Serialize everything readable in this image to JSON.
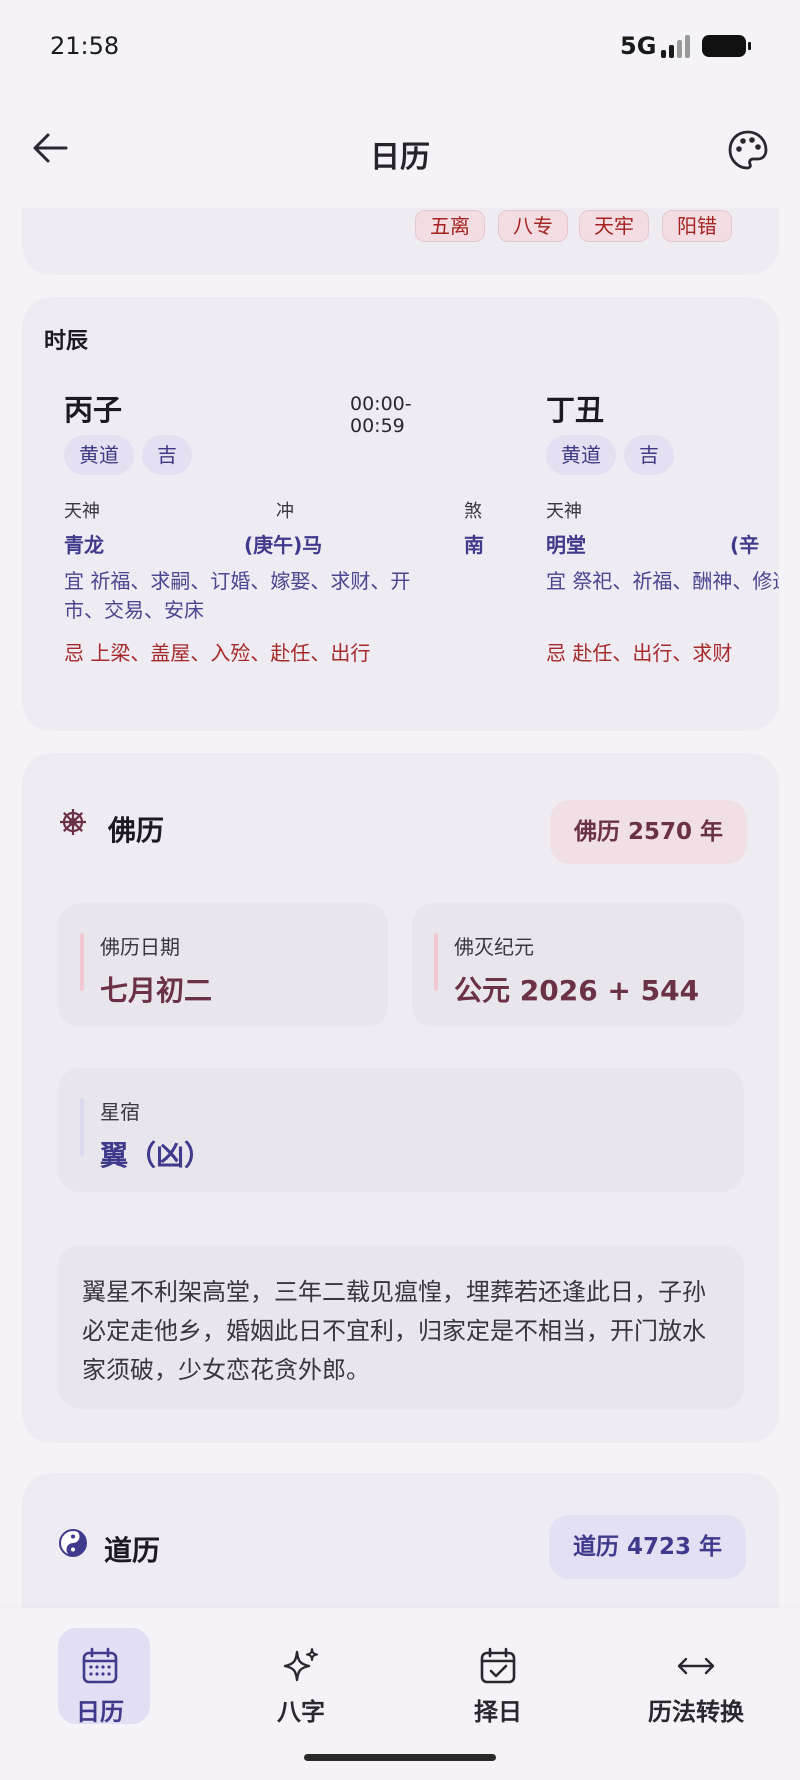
{
  "status": {
    "time": "21:58",
    "network": "5G"
  },
  "appbar": {
    "title": "日历"
  },
  "top_chips": [
    "五离",
    "八专",
    "天牢",
    "阳错"
  ],
  "shichen_card": {
    "title": "时辰",
    "items": [
      {
        "name": "丙子",
        "time": "00:00-00:59",
        "tags": [
          "黄道",
          "吉"
        ],
        "labels": {
          "tianshen": "天神",
          "chong": "冲",
          "sha": "煞"
        },
        "tianshen": "青龙",
        "chong": "(庚午)马",
        "sha": "南",
        "yi": "宜 祈福、求嗣、订婚、嫁娶、求财、开市、交易、安床",
        "ji": "忌 上梁、盖屋、入殓、赴任、出行"
      },
      {
        "name": "丁丑",
        "time": "",
        "tags": [
          "黄道",
          "吉"
        ],
        "labels": {
          "tianshen": "天神"
        },
        "tianshen": "明堂",
        "chong": "(辛",
        "yi": "宜 祭祀、祈福、酬神、修造、安葬",
        "ji": "忌 赴任、出行、求财"
      }
    ]
  },
  "buddhist_card": {
    "icon": "dharma-wheel-icon",
    "title": "佛历",
    "year_badge": "佛历 2570 年",
    "date_label": "佛历日期",
    "date_value": "七月初二",
    "era_label": "佛灭纪元",
    "era_value": "公元 2026 + 544",
    "star_label": "星宿",
    "star_value": "翼（凶）",
    "poem": "翼星不利架高堂，三年二载见瘟惶，埋葬若还逢此日，子孙必定走他乡，婚姻此日不宜利，归家定是不相当，开门放水家须破，少女恋花贪外郎。",
    "colors": {
      "accent": "#6b3147",
      "badge_bg": "#f1dfe6",
      "bar": "#f0c9d3"
    }
  },
  "taoist_card": {
    "icon": "yin-yang-icon",
    "title": "道历",
    "year_badge": "道历 4723 年",
    "colors": {
      "accent": "#3f3a8b",
      "badge_bg": "#e3e0f4"
    }
  },
  "bottom_nav": {
    "items": [
      {
        "label": "日历",
        "icon": "calendar-icon",
        "active": true
      },
      {
        "label": "八字",
        "icon": "sparkle-icon",
        "active": false
      },
      {
        "label": "择日",
        "icon": "calendar-check-icon",
        "active": false
      },
      {
        "label": "历法转换",
        "icon": "swap-arrows-icon",
        "active": false
      }
    ]
  }
}
